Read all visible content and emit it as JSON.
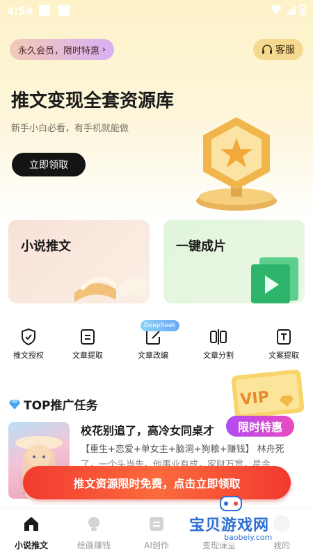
{
  "status_bar": {
    "time": "4:54"
  },
  "header": {
    "vip_pill_label": "永久会员，限时特惠",
    "vip_pill_chevron": "›",
    "service_label": "客服"
  },
  "hero": {
    "title": "推文变现全套资源库",
    "subtitle": "新手小白必看，有手机就能做",
    "claim_button": "立即领取"
  },
  "cards": [
    {
      "label": "小说推文"
    },
    {
      "label": "一键成片"
    }
  ],
  "tools": {
    "items": [
      {
        "label": "推文授权",
        "icon": "shield-check-icon"
      },
      {
        "label": "文章提取",
        "icon": "document-icon"
      },
      {
        "label": "文章改编",
        "icon": "edit-icon"
      },
      {
        "label": "文章分割",
        "icon": "split-icon"
      },
      {
        "label": "文案提取",
        "icon": "text-icon"
      }
    ],
    "deepseek_tag": "DeepSeek"
  },
  "section": {
    "title": "TOP推广任务"
  },
  "vip_float": {
    "vip_text": "VIP",
    "limited_label": "限时特惠"
  },
  "task": {
    "title": "校花别追了，高冷女同桌才",
    "tags": "【重生+恋爱+单女主+脑洞+狗粮+赚钱】 林舟死",
    "desc": "了，一个头当先，他事业有成，家财万贯，星金"
  },
  "promo_banner": {
    "label": "推文资源限时免费，点击立即领取"
  },
  "tabbar": {
    "items": [
      {
        "label": "小说推文",
        "active": true
      },
      {
        "label": "绘画赚钱",
        "active": false
      },
      {
        "label": "AI创作",
        "active": false
      },
      {
        "label": "变现课堂",
        "active": false
      },
      {
        "label": "我的",
        "active": false
      }
    ]
  },
  "watermark": {
    "text": "宝贝游戏网",
    "url": "baobeiy.com"
  },
  "colors": {
    "hero_bg": "#fdf2c8",
    "promo_red": "#f23a2f",
    "limited_purple": "#b24bf3",
    "watermark_blue": "#2c6fd4"
  }
}
